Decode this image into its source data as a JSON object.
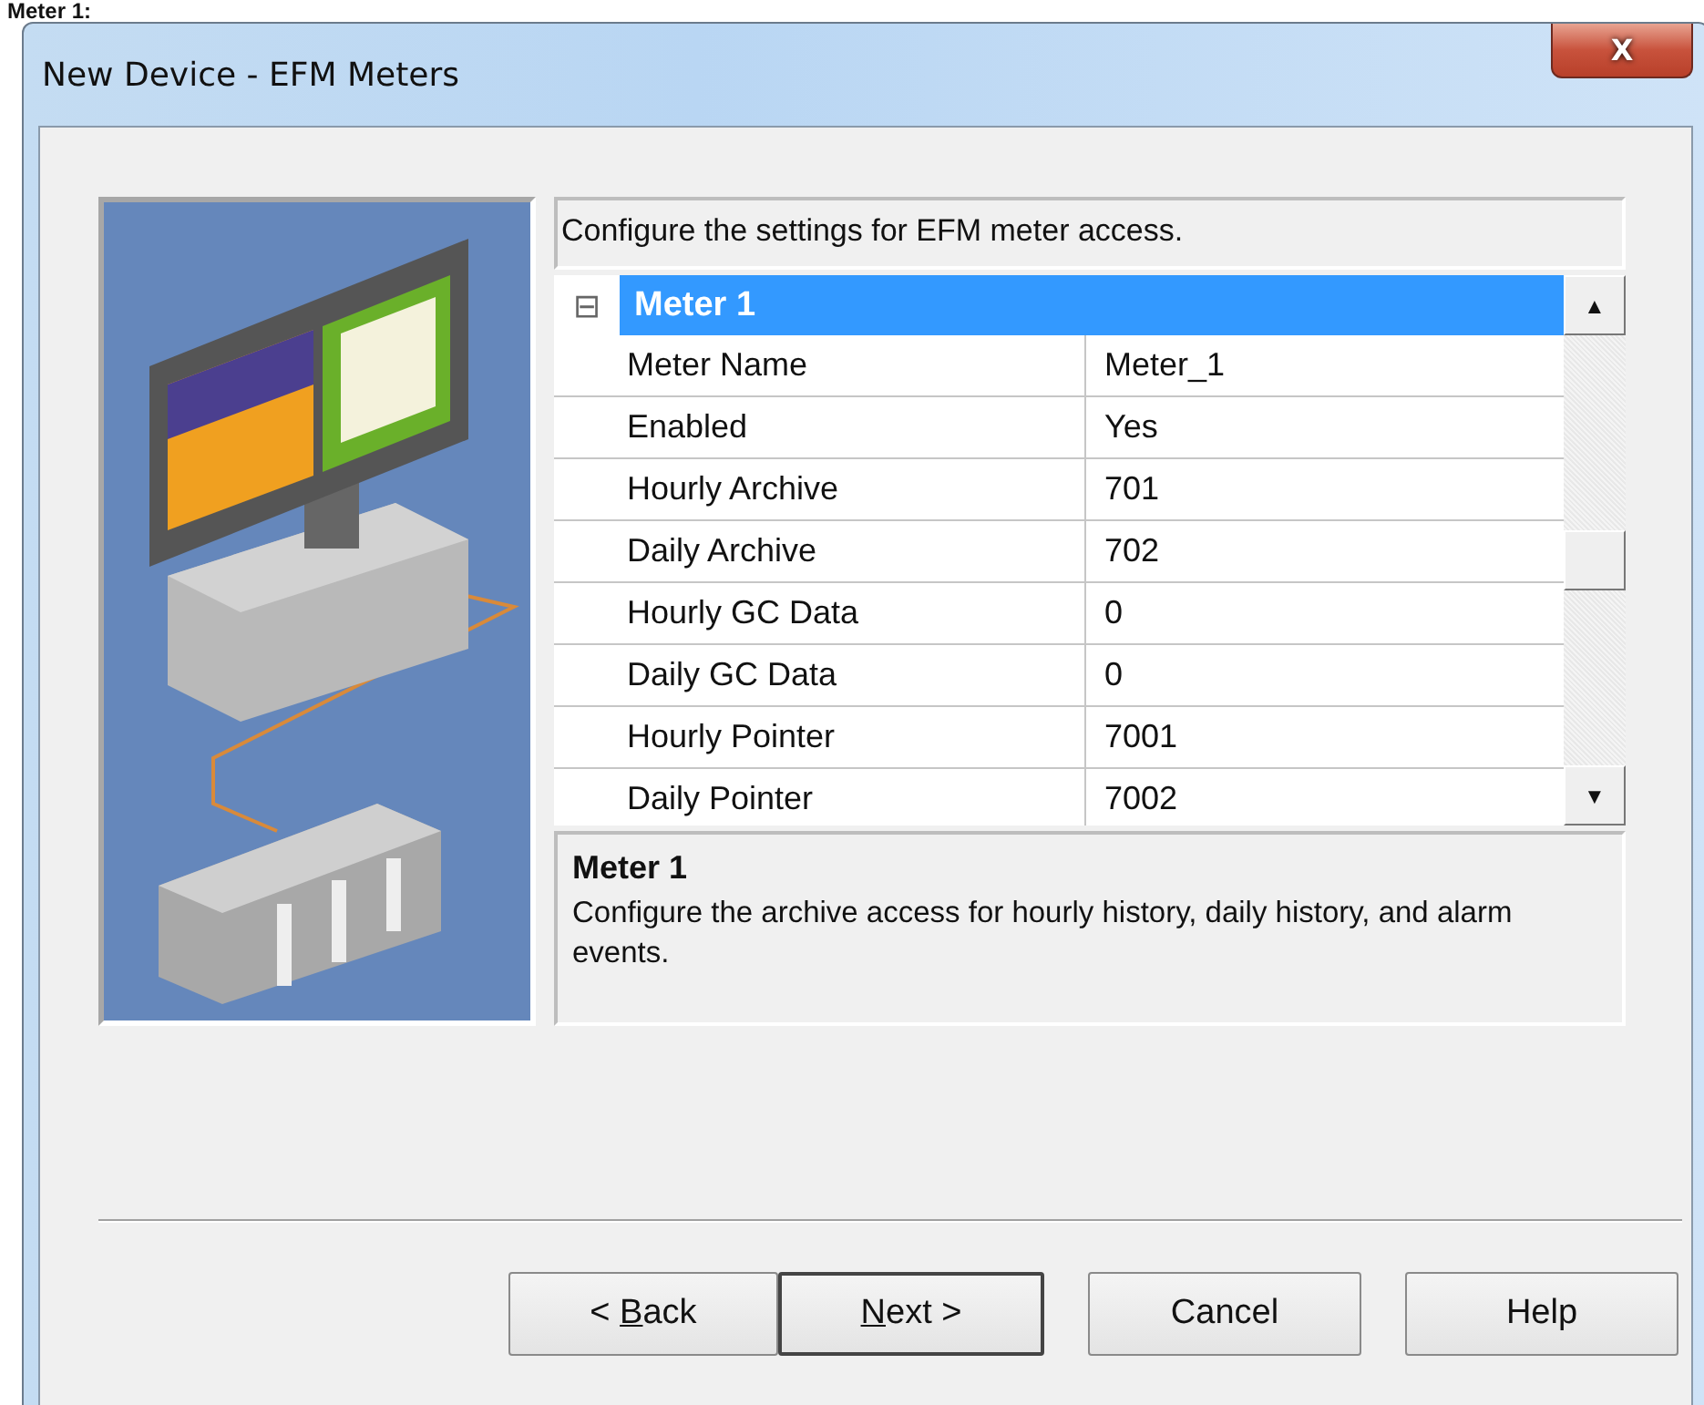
{
  "page_heading": "Meter 1:",
  "window": {
    "title": "New Device - EFM Meters",
    "close": "X"
  },
  "description": "Configure the settings for EFM meter access.",
  "property_grid": {
    "category": {
      "label": "Meter 1",
      "expanded": true,
      "selected": true,
      "toggle": "⊟"
    },
    "rows": [
      {
        "name": "Meter Name",
        "value": "Meter_1"
      },
      {
        "name": "Enabled",
        "value": "Yes"
      },
      {
        "name": "Hourly Archive",
        "value": "701"
      },
      {
        "name": "Daily Archive",
        "value": "702"
      },
      {
        "name": "Hourly GC Data",
        "value": "0"
      },
      {
        "name": "Daily GC Data",
        "value": "0"
      },
      {
        "name": "Hourly Pointer",
        "value": "7001"
      },
      {
        "name": "Daily Pointer",
        "value": "7002"
      }
    ],
    "scrollbar": {
      "up": "▲",
      "down": "▼"
    }
  },
  "help_panel": {
    "title": "Meter 1",
    "text": "Configure the archive access for hourly history, daily history, and alarm events."
  },
  "buttons": [
    {
      "prefix": "< ",
      "mnemonic": "B",
      "suffix": "ack",
      "default": false
    },
    {
      "mnemonic": "N",
      "suffix": "ext >",
      "default": true
    },
    {
      "label": "Cancel",
      "default": false
    },
    {
      "label": "Help",
      "default": false
    }
  ]
}
